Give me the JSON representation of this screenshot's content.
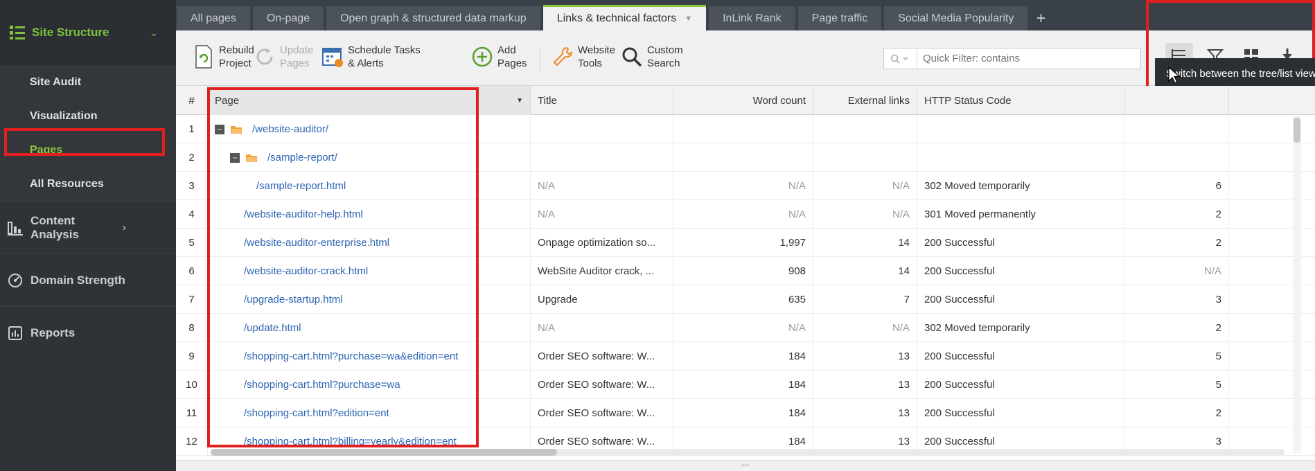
{
  "sidebar": {
    "header": {
      "label": "Site Structure",
      "icon": "site-structure-icon"
    },
    "subitems": [
      {
        "label": "Site Audit",
        "active": false
      },
      {
        "label": "Visualization",
        "active": false
      },
      {
        "label": "Pages",
        "active": true
      },
      {
        "label": "All Resources",
        "active": false
      }
    ],
    "sections": [
      {
        "label": "Content Analysis",
        "icon": "content-analysis-icon"
      },
      {
        "label": "Domain Strength",
        "icon": "domain-strength-icon"
      },
      {
        "label": "Reports",
        "icon": "reports-icon"
      }
    ]
  },
  "tabs": [
    {
      "label": "All pages",
      "active": false
    },
    {
      "label": "On-page",
      "active": false
    },
    {
      "label": "Open graph & structured data markup",
      "active": false
    },
    {
      "label": "Links & technical factors",
      "active": true
    },
    {
      "label": "InLink Rank",
      "active": false
    },
    {
      "label": "Page traffic",
      "active": false
    },
    {
      "label": "Social Media Popularity",
      "active": false
    }
  ],
  "toolbar": {
    "rebuild": {
      "line1": "Rebuild",
      "line2": "Project"
    },
    "update": {
      "line1": "Update",
      "line2": "Pages"
    },
    "schedule": {
      "line1": "Schedule Tasks",
      "line2": "& Alerts"
    },
    "add": {
      "line1": "Add",
      "line2": "Pages"
    },
    "tools": {
      "line1": "Website",
      "line2": "Tools"
    },
    "search": {
      "line1": "Custom",
      "line2": "Search"
    },
    "filter_placeholder": "Quick Filter: contains"
  },
  "tooltip": "Switch between the tree/list view",
  "colors": {
    "accent": "#8cc63f",
    "link": "#2d64b3",
    "highlight": "#e02020"
  },
  "table": {
    "headers": {
      "num": "#",
      "page": "Page",
      "title": "Title",
      "words": "Word count",
      "ext": "External links",
      "status": "HTTP Status Code"
    },
    "rows": [
      {
        "n": "1",
        "page": "/website-auditor/",
        "title": "",
        "words": "",
        "ext": "",
        "status": "",
        "last": ""
      },
      {
        "n": "2",
        "page": "/sample-report/",
        "title": "",
        "words": "",
        "ext": "",
        "status": "",
        "last": ""
      },
      {
        "n": "3",
        "page": "/sample-report.html",
        "title": "N/A",
        "words": "N/A",
        "ext": "N/A",
        "status": "302 Moved temporarily",
        "last": "6"
      },
      {
        "n": "4",
        "page": "/website-auditor-help.html",
        "title": "N/A",
        "words": "N/A",
        "ext": "N/A",
        "status": "301 Moved permanently",
        "last": "2"
      },
      {
        "n": "5",
        "page": "/website-auditor-enterprise.html",
        "title": "Onpage optimization so...",
        "words": "1,997",
        "ext": "14",
        "status": "200 Successful",
        "last": "2"
      },
      {
        "n": "6",
        "page": "/website-auditor-crack.html",
        "title": "WebSite Auditor crack, ...",
        "words": "908",
        "ext": "14",
        "status": "200 Successful",
        "last": "N/A"
      },
      {
        "n": "7",
        "page": "/upgrade-startup.html",
        "title": "Upgrade",
        "words": "635",
        "ext": "7",
        "status": "200 Successful",
        "last": "3"
      },
      {
        "n": "8",
        "page": "/update.html",
        "title": "N/A",
        "words": "N/A",
        "ext": "N/A",
        "status": "302 Moved temporarily",
        "last": "2"
      },
      {
        "n": "9",
        "page": "/shopping-cart.html?purchase=wa&edition=ent",
        "title": "Order SEO software: W...",
        "words": "184",
        "ext": "13",
        "status": "200 Successful",
        "last": "5"
      },
      {
        "n": "10",
        "page": "/shopping-cart.html?purchase=wa",
        "title": "Order SEO software: W...",
        "words": "184",
        "ext": "13",
        "status": "200 Successful",
        "last": "5"
      },
      {
        "n": "11",
        "page": "/shopping-cart.html?edition=ent",
        "title": "Order SEO software: W...",
        "words": "184",
        "ext": "13",
        "status": "200 Successful",
        "last": "2"
      },
      {
        "n": "12",
        "page": "/shopping-cart.html?billing=yearly&edition=ent",
        "title": "Order SEO software: W...",
        "words": "184",
        "ext": "13",
        "status": "200 Successful",
        "last": "3"
      }
    ]
  }
}
